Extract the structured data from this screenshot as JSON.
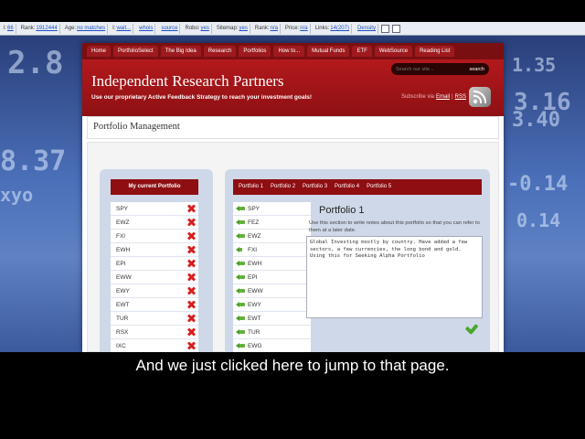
{
  "browser_toolbar": {
    "items": [
      {
        "k": "l:",
        "v": "66"
      },
      {
        "k": "Rank:",
        "v": "1912444"
      },
      {
        "k": "Age:",
        "v": "no matches"
      },
      {
        "k": "I:",
        "v": "wait..."
      },
      {
        "k": "",
        "v": "whois"
      },
      {
        "k": "",
        "v": "source"
      },
      {
        "k": "Robo:",
        "v": "yes"
      },
      {
        "k": "Sitemap:",
        "v": "yes"
      },
      {
        "k": "Rank:",
        "v": "n/a"
      },
      {
        "k": "Price:",
        "v": "n/a"
      },
      {
        "k": "Links:",
        "v": "14(207)"
      },
      {
        "k": "",
        "v": "Density"
      }
    ]
  },
  "background_ticker": [
    "2.8",
    "1.35",
    "3.16",
    "-0.14",
    "3.40",
    "8.37",
    "xyo",
    "0.14"
  ],
  "nav": {
    "items": [
      "Home",
      "PortfolioSelect",
      "The Big Idea",
      "Research",
      "Portfolios",
      "How to...",
      "Mutual Funds",
      "ETF",
      "WebSource",
      "Reading List"
    ]
  },
  "header": {
    "title": "Independent Research Partners",
    "tagline": "Use our proprietary Active Feedback Strategy to reach your investment goals!",
    "search_placeholder": "Search our site...",
    "search_button": "search",
    "subscribe_label": "Subscribe via",
    "subscribe_email": "Email",
    "subscribe_sep": "|",
    "subscribe_rss": "RSS"
  },
  "page": {
    "heading": "Portfolio Management"
  },
  "current_portfolio": {
    "heading": "My current Portfolio",
    "items": [
      "SPY",
      "EWZ",
      "FXI",
      "EWH",
      "EPI",
      "EWW",
      "EWY",
      "EWT",
      "TUR",
      "RSX",
      "IXC"
    ]
  },
  "portfolio_editor": {
    "tabs": [
      "Portfolio 1",
      "Portfolio 2",
      "Portfolio 3",
      "Portfolio 4",
      "Portfolio 5"
    ],
    "items": [
      "SPY",
      "FEZ",
      "EWZ",
      "FXI",
      "EWH",
      "EPI",
      "EWW",
      "EWY",
      "EWT",
      "TUR",
      "EWG"
    ],
    "title": "Portfolio 1",
    "help": "Use this section to write notes about this portfolio so that you can refer to them at a later date.",
    "notes": "Global Investing mostly by country. Have added a few sectors, a few currencies, the long bond and gold. Using this for Seeking Alpha Portfolio"
  },
  "caption": "And we just clicked here to jump to that page."
}
